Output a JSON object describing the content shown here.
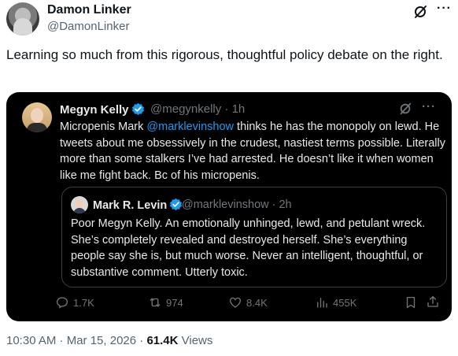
{
  "outer": {
    "name": "Damon Linker",
    "handle": "@DamonLinker",
    "text": "Learning so much from this rigorous, thoughtful policy debate on the right.",
    "icons": [
      "grok-icon",
      "more-icon"
    ]
  },
  "inner": {
    "name": "Megyn Kelly",
    "handle": "@megynkelly · 1h",
    "mention": "@marklevinshow",
    "text_before": "Micropenis Mark ",
    "text_after": " thinks he has the monopoly on lewd. He tweets about me obsessively in the crudest, nastiest terms possible. Literally more than some stalkers I’ve had arrested. He doesn’t like it when women like me fight back. Bc of his micropenis.",
    "verified_color": "#1d9bf0"
  },
  "quote": {
    "name": "Mark R. Levin",
    "handle": "@marklevinshow · 2h",
    "text": "Poor Megyn Kelly.  An emotionally unhinged, lewd, and petulant wreck.  She’s completely revealed and destroyed herself. She’s everything people say she is, but much worse.  Never an intelligent, thoughtful, or substantive comment. Utterly toxic."
  },
  "actions": {
    "replies": "1.7K",
    "reposts": "974",
    "likes": "8.4K",
    "views": "455K"
  },
  "footer": {
    "timestamp": "10:30 AM · Mar 15, 2026 · ",
    "views_count": "61.4K",
    "views_label": " Views"
  }
}
